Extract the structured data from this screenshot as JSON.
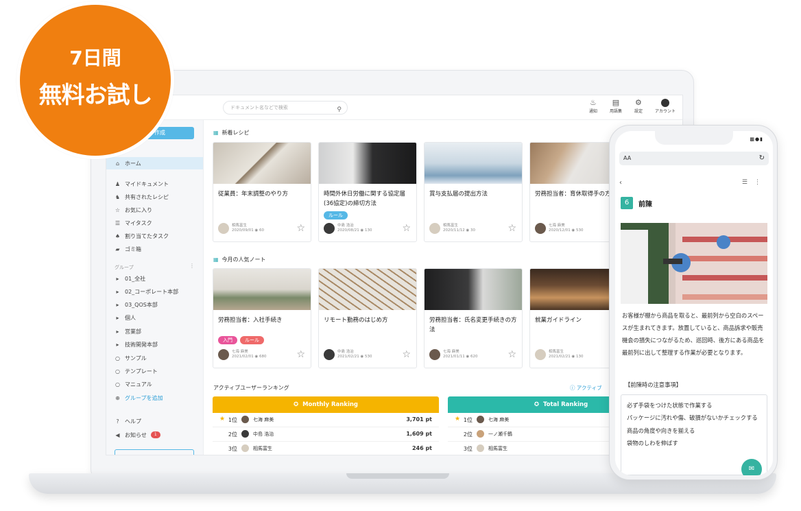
{
  "promo": {
    "line1": "7日間",
    "line2": "無料お試し"
  },
  "header": {
    "search_placeholder": "ドキュメント名などで検索",
    "icons": [
      {
        "name": "bell-icon",
        "label": "通知"
      },
      {
        "name": "document-icon",
        "label": "用語集"
      },
      {
        "name": "gear-icon",
        "label": "設定"
      },
      {
        "name": "account-icon",
        "label": "アカウント"
      }
    ]
  },
  "sidebar": {
    "create_label": "作成",
    "home": "ホーム",
    "items": [
      {
        "icon": "person-icon",
        "label": "マイドキュメント"
      },
      {
        "icon": "people-icon",
        "label": "共有されたレシピ"
      },
      {
        "icon": "star-icon",
        "label": "お気に入り"
      },
      {
        "icon": "list-icon",
        "label": "マイタスク"
      },
      {
        "icon": "assign-icon",
        "label": "割り当てたタスク"
      },
      {
        "icon": "trash-icon",
        "label": "ゴミ箱"
      }
    ],
    "group_heading": "グループ",
    "groups": [
      {
        "marker": "▸",
        "label": "01_全社"
      },
      {
        "marker": "▸",
        "label": "02_コーポレート本部"
      },
      {
        "marker": "▸",
        "label": "03_QOS本部"
      },
      {
        "marker": "▸",
        "label": "個人"
      },
      {
        "marker": "▸",
        "label": "営業部"
      },
      {
        "marker": "▸",
        "label": "技術開発本部"
      },
      {
        "marker": "○",
        "label": "サンプル"
      },
      {
        "marker": "○",
        "label": "テンプレート"
      },
      {
        "marker": "○",
        "label": "マニュアル"
      }
    ],
    "add_group": "グループを追加",
    "help": "ヘルプ",
    "notice": "お知らせ",
    "notice_count": "1"
  },
  "new_recipes": {
    "title": "新着レシピ",
    "cards": [
      {
        "title": "従業員：年末調整のやり方",
        "tags": [],
        "author": "相馬富生",
        "date": "2020/09/01",
        "views": "60"
      },
      {
        "title": "時間外休日労働に関する協定届(36協定)の締切方法",
        "tags": [
          {
            "label": "ルール",
            "color": "blue"
          }
        ],
        "author": "中島 浩治",
        "date": "2020/08/21",
        "views": "130"
      },
      {
        "title": "賞与支払届の提出方法",
        "tags": [],
        "author": "相馬富生",
        "date": "2020/11/12",
        "views": "30"
      },
      {
        "title": "労務担当者：育休取得手の方法",
        "tags": [],
        "author": "七海 麻美",
        "date": "2020/12/01",
        "views": "530"
      }
    ]
  },
  "popular_notes": {
    "title": "今月の人気ノート",
    "cards": [
      {
        "title": "労務担当者：入社手続き",
        "tags": [
          {
            "label": "入門",
            "color": "pink"
          },
          {
            "label": "ルール",
            "color": "red"
          }
        ],
        "author": "七海 麻美",
        "date": "2021/02/01",
        "views": "680"
      },
      {
        "title": "リモート勤務のはじめ方",
        "tags": [],
        "author": "中島 浩治",
        "date": "2021/02/21",
        "views": "530"
      },
      {
        "title": "労務担当者：氏名変更手続きの方法",
        "tags": [],
        "author": "七海 麻美",
        "date": "2021/01/11",
        "views": "620"
      },
      {
        "title": "就業ガイドライン",
        "tags": [],
        "author": "相馬富生",
        "date": "2021/02/21",
        "views": "130"
      }
    ]
  },
  "ranking": {
    "title": "アクティブユーザーランキング",
    "info_link": "アクティブ",
    "monthly": {
      "label": "Monthly Ranking",
      "color": "#f5b400",
      "rows": [
        {
          "rank": "1位",
          "name": "七海 麻美",
          "points": "3,701 pt"
        },
        {
          "rank": "2位",
          "name": "中島 浩治",
          "points": "1,609 pt"
        },
        {
          "rank": "3位",
          "name": "相馬富生",
          "points": "246 pt"
        }
      ]
    },
    "total": {
      "label": "Total Ranking",
      "color": "#2bb9a9",
      "rows": [
        {
          "rank": "1位",
          "name": "七海 麻美"
        },
        {
          "rank": "2位",
          "name": "一ノ瀬千鶴"
        },
        {
          "rank": "3位",
          "name": "相馬富生"
        }
      ]
    }
  },
  "phone": {
    "url_text": "AA",
    "step_number": "6",
    "step_title": "前陳",
    "body": "お客様が棚から商品を取ると、最前列から空白のスペースが生まれてきます。放置していると、商品訴求や販売機会の損失につながるため、巡回時、後方にある商品を最前列に出して整理する作業が必要となります。",
    "note_heading": "【前陳時の注意事項】",
    "note_lines": [
      "必ず手袋をつけた状態で作業する",
      "パッケージに汚れや傷、破損がないかチェックする",
      "商品の角度や向きを揃える",
      "袋物のしわを伸ばす"
    ]
  }
}
